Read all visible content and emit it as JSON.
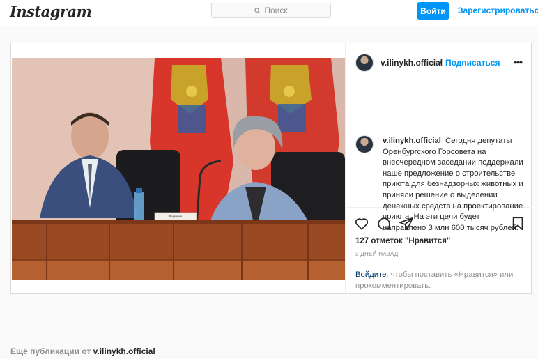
{
  "header": {
    "logo_text": "Instagram",
    "search_placeholder": "Поиск",
    "login_label": "Войти",
    "signup_label": "Зарегистрироваться"
  },
  "post": {
    "author": "v.ilinykh.official",
    "follow_label": "Подписаться",
    "separator": "•",
    "more_label": "•••",
    "caption": "Сегодня депутаты Оренбургского Горсовета на внеочередном заседании поддержали наше предложение о строительстве приюта для безнадзорных животных и приняли решение о выделении денежных средств на проектирование приюта. На эти цели будет направлено 3 млн 600 тысяч рублей.",
    "likes": "127 отметок \"Нравится\"",
    "time": "3 ДНЕЙ НАЗАД",
    "login_link": "Войдите",
    "login_hint": ", чтобы поставить «Нравится» или прокомментировать.",
    "photo_nameplate": "Березина Ольга Петровна"
  },
  "footer": {
    "more_posts_prefix": "Ещё публикации от",
    "more_posts_author": "v.ilinykh.official"
  },
  "colors": {
    "accent": "#0095f6",
    "border": "#dbdbdb",
    "text": "#262626",
    "muted": "#8e8e8e"
  }
}
